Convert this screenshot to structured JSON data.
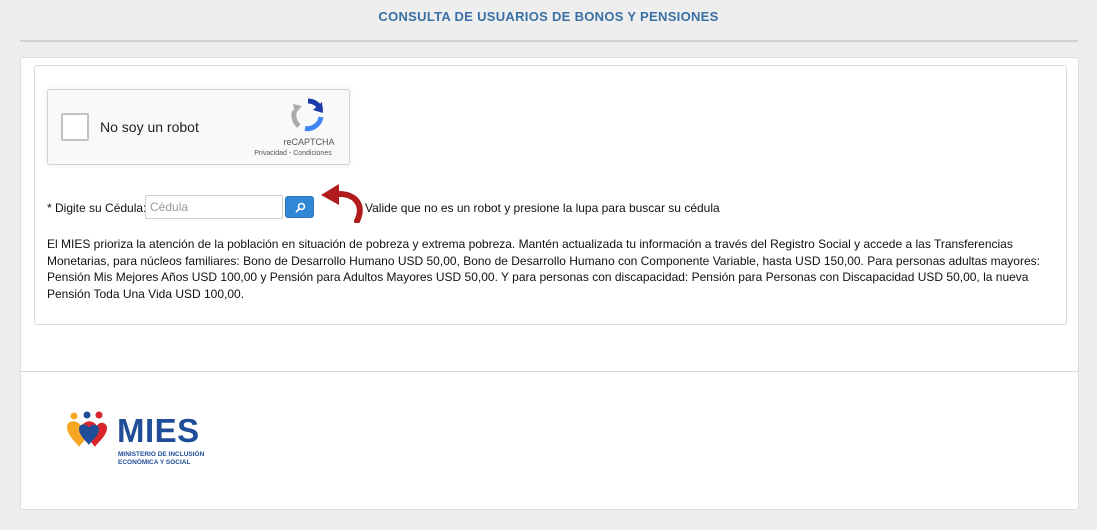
{
  "header": {
    "title": "CONSULTA DE USUARIOS DE BONOS Y PENSIONES"
  },
  "recaptcha": {
    "label": "No soy un robot",
    "brand": "reCAPTCHA",
    "privacy_link": "Privacidad",
    "separator": " - ",
    "terms_link": "Condiciones"
  },
  "search": {
    "label": "* Digite su Cédula:",
    "placeholder": "Cédula",
    "value": "",
    "button_icon": "search-icon",
    "hint": "Valide que no es un robot y presione la lupa para buscar su cédula"
  },
  "info": {
    "text": "El MIES prioriza la atención de la población en situación de pobreza y extrema pobreza. Mantén actualizada tu información a través del Registro Social y accede a las Transferencias Monetarias, para núcleos familiares: Bono de Desarrollo Humano USD 50,00, Bono de Desarrollo Humano con Componente Variable, hasta USD 150,00. Para personas adultas mayores: Pensión Mis Mejores Años USD 100,00 y Pensión para Adultos Mayores USD 50,00. Y para personas con discapacidad: Pensión para Personas con Discapacidad USD 50,00, la nueva Pensión Toda Una Vida USD 100,00."
  },
  "footer": {
    "logo_text": "MIES",
    "logo_subtitle_line1": "MINISTERIO DE INCLUSIÓN",
    "logo_subtitle_line2": "ECONÓMICA Y SOCIAL"
  },
  "colors": {
    "title": "#3a70a6",
    "search_button": "#2f87d6",
    "arrow": "#b01c1c",
    "logo_blue": "#1f4d97"
  }
}
